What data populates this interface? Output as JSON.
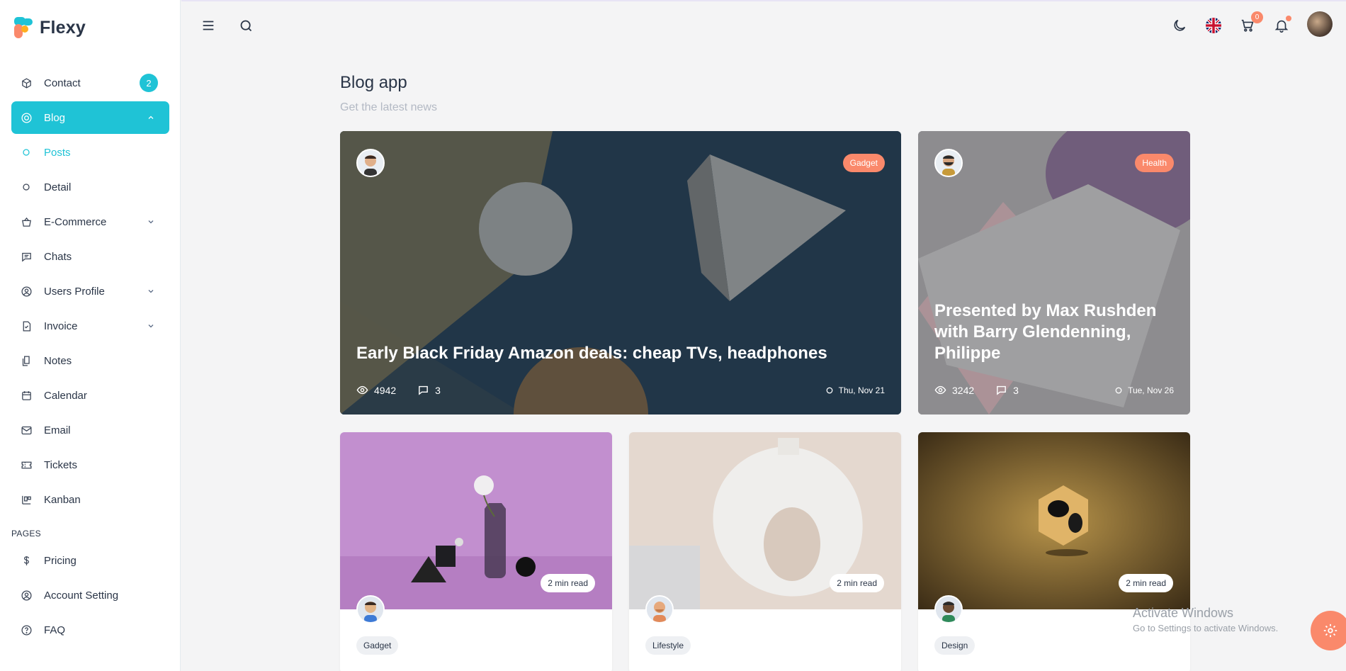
{
  "brand": {
    "name": "Flexy"
  },
  "sidebar": {
    "items": [
      {
        "label": "Contact",
        "badge": "2",
        "icon": "box-icon"
      },
      {
        "label": "Blog",
        "icon": "aperture-icon",
        "state": "expanded"
      },
      {
        "label": "Posts",
        "icon": "circle-icon"
      },
      {
        "label": "Detail",
        "icon": "circle-icon"
      },
      {
        "label": "E-Commerce",
        "icon": "basket-icon"
      },
      {
        "label": "Chats",
        "icon": "message-icon"
      },
      {
        "label": "Users Profile",
        "icon": "user-circle-icon"
      },
      {
        "label": "Invoice",
        "icon": "file-check-icon"
      },
      {
        "label": "Notes",
        "icon": "notes-icon"
      },
      {
        "label": "Calendar",
        "icon": "calendar-icon"
      },
      {
        "label": "Email",
        "icon": "mail-icon"
      },
      {
        "label": "Tickets",
        "icon": "ticket-icon"
      },
      {
        "label": "Kanban",
        "icon": "kanban-icon"
      }
    ],
    "section_pages": "PAGES",
    "pages": [
      {
        "label": "Pricing",
        "icon": "dollar-icon"
      },
      {
        "label": "Account Setting",
        "icon": "user-circle-icon"
      },
      {
        "label": "FAQ",
        "icon": "help-icon"
      }
    ]
  },
  "topbar": {
    "cart_count": "0"
  },
  "main": {
    "title": "Blog app",
    "subtitle": "Get the latest news"
  },
  "featured": [
    {
      "title": "Early Black Friday Amazon deals: cheap TVs, headphones",
      "tag": "Gadget",
      "views": "4942",
      "comments": "3",
      "date": "Thu, Nov 21"
    },
    {
      "title": "Presented by Max Rushden with Barry Glendenning, Philippe",
      "tag": "Health",
      "views": "3242",
      "comments": "3",
      "date": "Tue, Nov 26"
    }
  ],
  "posts": [
    {
      "read": "2 min read",
      "category": "Gadget"
    },
    {
      "read": "2 min read",
      "category": "Lifestyle"
    },
    {
      "read": "2 min read",
      "category": "Design"
    }
  ],
  "watermark": {
    "line1": "Activate Windows",
    "line2": "Go to Settings to activate Windows."
  },
  "colors": {
    "accent": "#1fc3d6",
    "tag": "#fa896b"
  }
}
